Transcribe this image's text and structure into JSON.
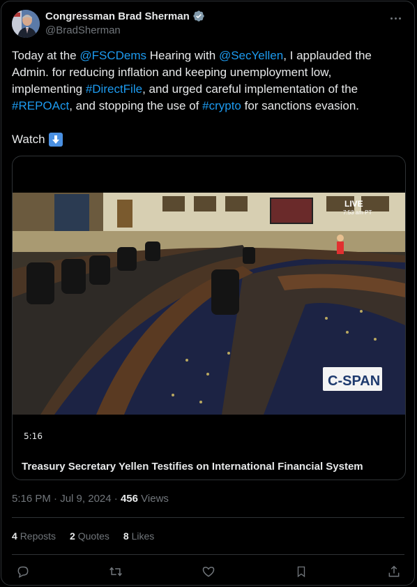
{
  "author": {
    "display_name": "Congressman Brad Sherman",
    "handle": "@BradSherman"
  },
  "tweet": {
    "t1": "Today at the ",
    "m1": "@FSCDems",
    "t2": " Hearing with ",
    "m2": "@SecYellen",
    "t3": ", I applauded the Admin. for reducing inflation and keeping unemployment low, implementing ",
    "h1": "#DirectFile",
    "t4": ", and urged careful implementation of the ",
    "h2": "#REPOAct",
    "t5": ", and stopping the use of ",
    "h3": "#crypto",
    "t6": " for sanctions evasion.",
    "watch": "Watch"
  },
  "media": {
    "live_label": "LIVE",
    "live_time": "7:53 am PT",
    "network_logo": "C-SPAN",
    "duration": "5:16",
    "title": "Treasury Secretary Yellen Testifies on International Financial System"
  },
  "meta": {
    "time": "5:16 PM",
    "date": "Jul 9, 2024",
    "sep": "·",
    "views_count": "456",
    "views_label": "Views"
  },
  "stats": {
    "reposts_count": "4",
    "reposts_label": "Reposts",
    "quotes_count": "2",
    "quotes_label": "Quotes",
    "likes_count": "8",
    "likes_label": "Likes"
  },
  "icons": {
    "verified": "verified-badge-icon",
    "more": "more-icon",
    "arrow": "arrow-down-emoji-icon",
    "reply": "reply-icon",
    "repost": "repost-icon",
    "like": "like-icon",
    "bookmark": "bookmark-icon",
    "share": "share-icon"
  },
  "colors": {
    "link": "#1d9bf0",
    "verified": "#829aab",
    "secondary_text": "#71767b"
  }
}
